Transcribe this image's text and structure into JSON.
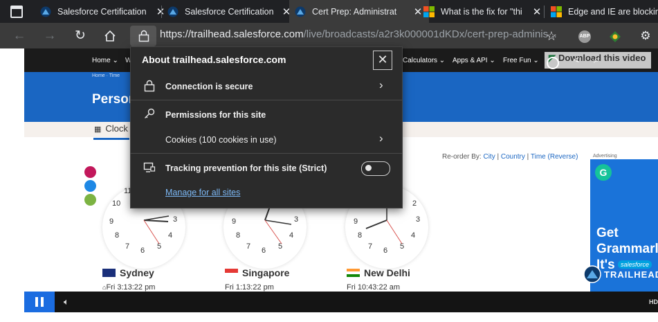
{
  "tabs": [
    {
      "title": "Salesforce Certification",
      "icon": "trailhead-icon"
    },
    {
      "title": "Salesforce Certification",
      "icon": "trailhead-icon"
    },
    {
      "title": "Cert Prep: Administrat",
      "icon": "trailhead-icon",
      "active": true
    },
    {
      "title": "What is the fix for \"thi",
      "icon": "microsoft-icon"
    },
    {
      "title": "Edge and IE are blockir",
      "icon": "microsoft-icon"
    }
  ],
  "address_bar": {
    "host": "https://trailhead.salesforce.com",
    "path": "/live/broadcasts/a2r3k000001dKDx/cert-prep-adminis..."
  },
  "site_nav": {
    "items": [
      "Home",
      "W",
      "Calculators",
      "Apps & API",
      "Free Fun"
    ],
    "download_label": "Download this video"
  },
  "breadcrumb": "Home · Time",
  "page_title": "Person",
  "clock_tab": "Clock",
  "reorder": {
    "prefix": "Re-order By:",
    "city": "City",
    "sep1": "|",
    "country": "Country",
    "sep2": "|",
    "time": "Time (Reverse)"
  },
  "ad": {
    "label": "Advertising",
    "headline_lines": [
      "Get",
      "Grammarl",
      "It's"
    ],
    "letter": "G"
  },
  "cities": [
    {
      "name": "Sydney",
      "time": "Fri 3:13:22 pm",
      "flag": "australia",
      "home": true
    },
    {
      "name": "Singapore",
      "time": "Fri 1:13:22 pm",
      "flag": "singapore"
    },
    {
      "name": "New Delhi",
      "time": "Fri 10:43:22 am",
      "flag": "india"
    }
  ],
  "clock_numbers": {
    "partial_left": [
      "11",
      "10"
    ],
    "partial_right": [
      "2"
    ]
  },
  "trailhead_logo": {
    "brand": "salesforce",
    "name": "TRAILHEAD"
  },
  "video": {
    "hd_label": "HD"
  },
  "popover": {
    "title": "About trailhead.salesforce.com",
    "connection": "Connection is secure",
    "permissions": "Permissions for this site",
    "cookies": "Cookies (100 cookies in use)",
    "tracking": "Tracking prevention for this site (Strict)",
    "tracking_enabled": false,
    "manage": "Manage for all sites"
  },
  "colors": {
    "accent": "#1a66c2",
    "chrome": "#202124",
    "popover": "#2b2b2b",
    "link": "#7cb8f5"
  }
}
